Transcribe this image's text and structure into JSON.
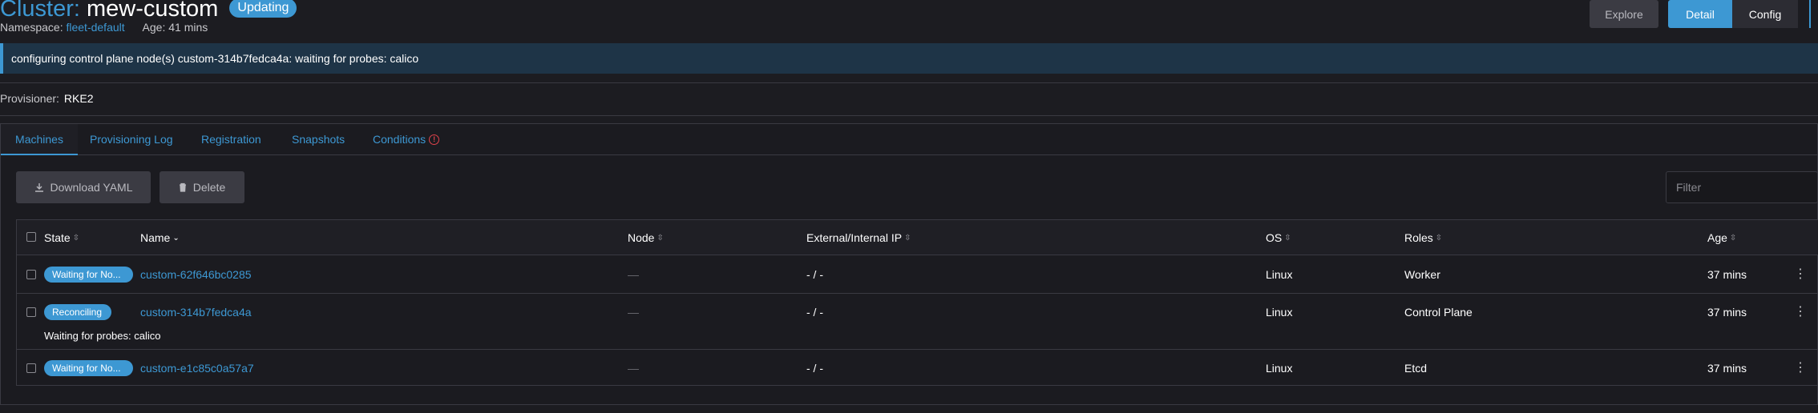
{
  "header": {
    "title_prefix": "Cluster:",
    "title_name": "mew-custom",
    "state_badge": "Updating",
    "namespace_label": "Namespace:",
    "namespace_value": "fleet-default",
    "age_text": "Age: 41 mins",
    "buttons": {
      "explore": "Explore",
      "detail": "Detail",
      "config": "Config"
    }
  },
  "banner": {
    "message": "configuring control plane node(s) custom-314b7fedca4a: waiting for probes: calico"
  },
  "provisioner": {
    "label": "Provisioner:",
    "value": "RKE2"
  },
  "tabs": [
    {
      "label": "Machines",
      "active": true
    },
    {
      "label": "Provisioning Log"
    },
    {
      "label": "Registration"
    },
    {
      "label": "Snapshots"
    },
    {
      "label": "Conditions",
      "icon": "error-icon"
    }
  ],
  "toolbar": {
    "download_label": "Download YAML",
    "delete_label": "Delete",
    "filter_placeholder": "Filter"
  },
  "table": {
    "columns": [
      "State",
      "Name",
      "Node",
      "External/Internal IP",
      "OS",
      "Roles",
      "Age"
    ],
    "rows": [
      {
        "state": "Waiting for No...",
        "name": "custom-62f646bc0285",
        "node": "—",
        "ip": "- / -",
        "os": "Linux",
        "roles": "Worker",
        "age": "37 mins"
      },
      {
        "state": "Reconciling",
        "name": "custom-314b7fedca4a",
        "node": "—",
        "ip": "- / -",
        "os": "Linux",
        "roles": "Control Plane",
        "age": "37 mins",
        "message": "Waiting for probes: calico"
      },
      {
        "state": "Waiting for No...",
        "name": "custom-e1c85c0a57a7",
        "node": "—",
        "ip": "- / -",
        "os": "Linux",
        "roles": "Etcd",
        "age": "37 mins"
      }
    ]
  },
  "colors": {
    "accent": "#3d98d3",
    "background": "#1c1c21",
    "error": "#e0434b"
  }
}
